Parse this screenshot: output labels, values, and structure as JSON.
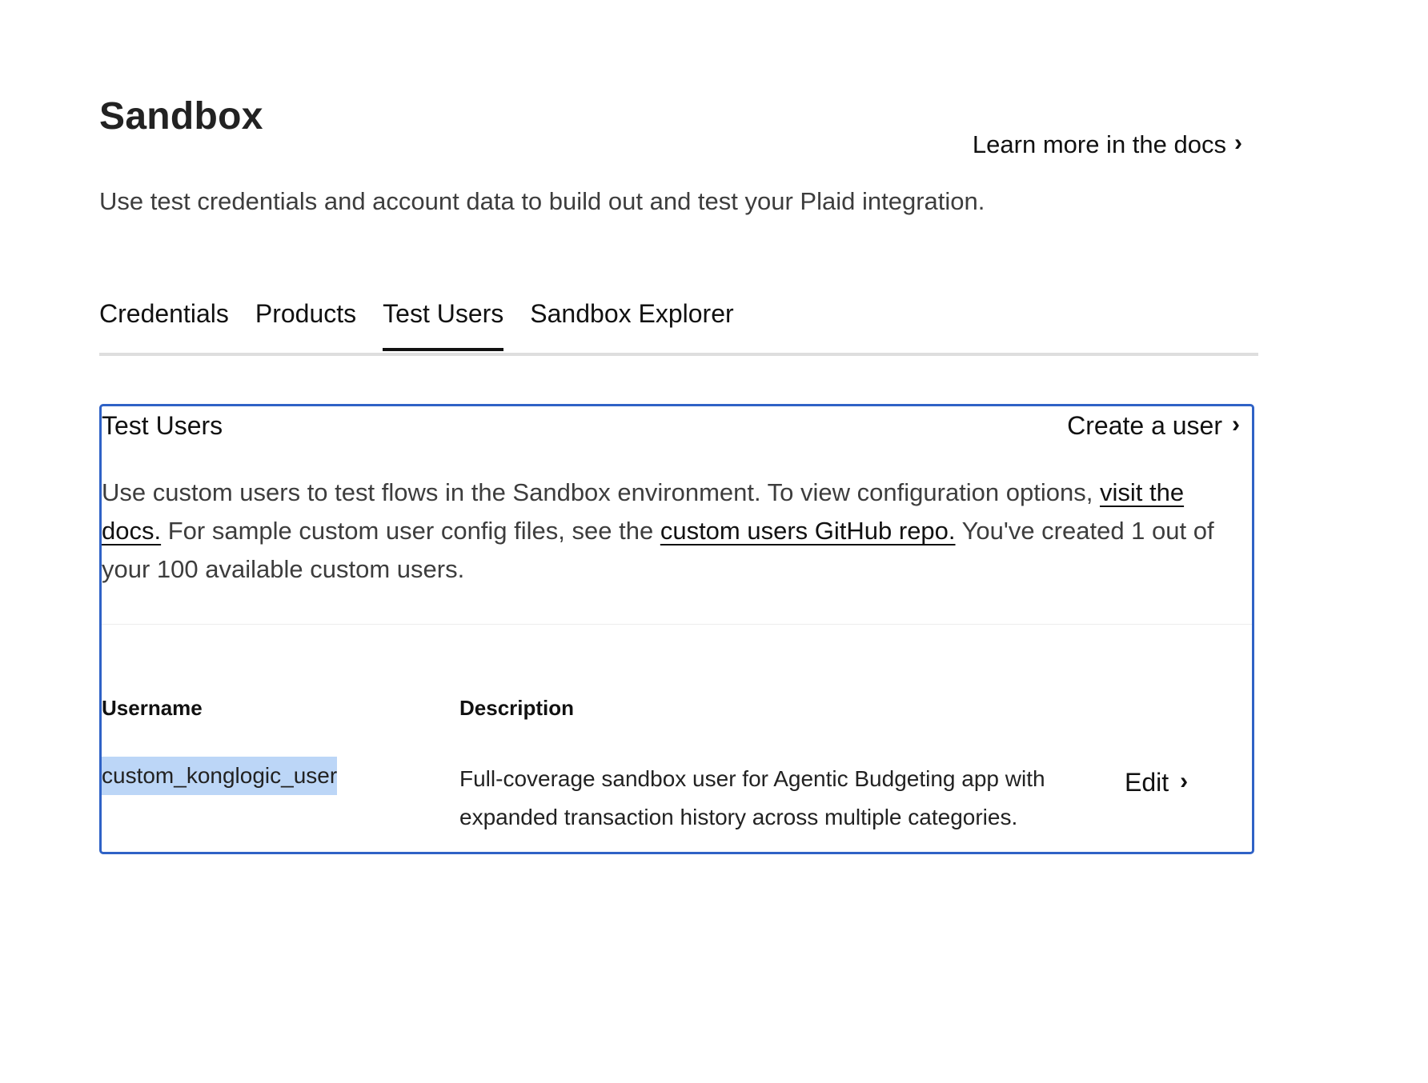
{
  "header": {
    "title": "Sandbox",
    "docs_link": "Learn more in the docs",
    "subtitle": "Use test credentials and account data to build out and test your Plaid integration."
  },
  "tabs": [
    {
      "label": "Credentials",
      "active": false
    },
    {
      "label": "Products",
      "active": false
    },
    {
      "label": "Test Users",
      "active": true
    },
    {
      "label": "Sandbox Explorer",
      "active": false
    }
  ],
  "panel": {
    "title": "Test Users",
    "create_link": "Create a user",
    "desc_part1": "Use custom users to test flows in the Sandbox environment. To view configuration options, ",
    "desc_link1": "visit the docs.",
    "desc_part2": " For sample custom user config files, see the ",
    "desc_link2": "custom users GitHub repo.",
    "desc_part3": " You've created 1 out of your 100 available custom users.",
    "accent_color": "#2f62c6"
  },
  "table": {
    "headers": {
      "username": "Username",
      "description": "Description"
    },
    "rows": [
      {
        "username": "custom_konglogic_user",
        "description": "Full-coverage sandbox user for Agentic Budgeting app with expanded transaction history across multiple categories.",
        "action": "Edit"
      }
    ]
  },
  "icons": {
    "chevron": "chevron-right-icon"
  }
}
